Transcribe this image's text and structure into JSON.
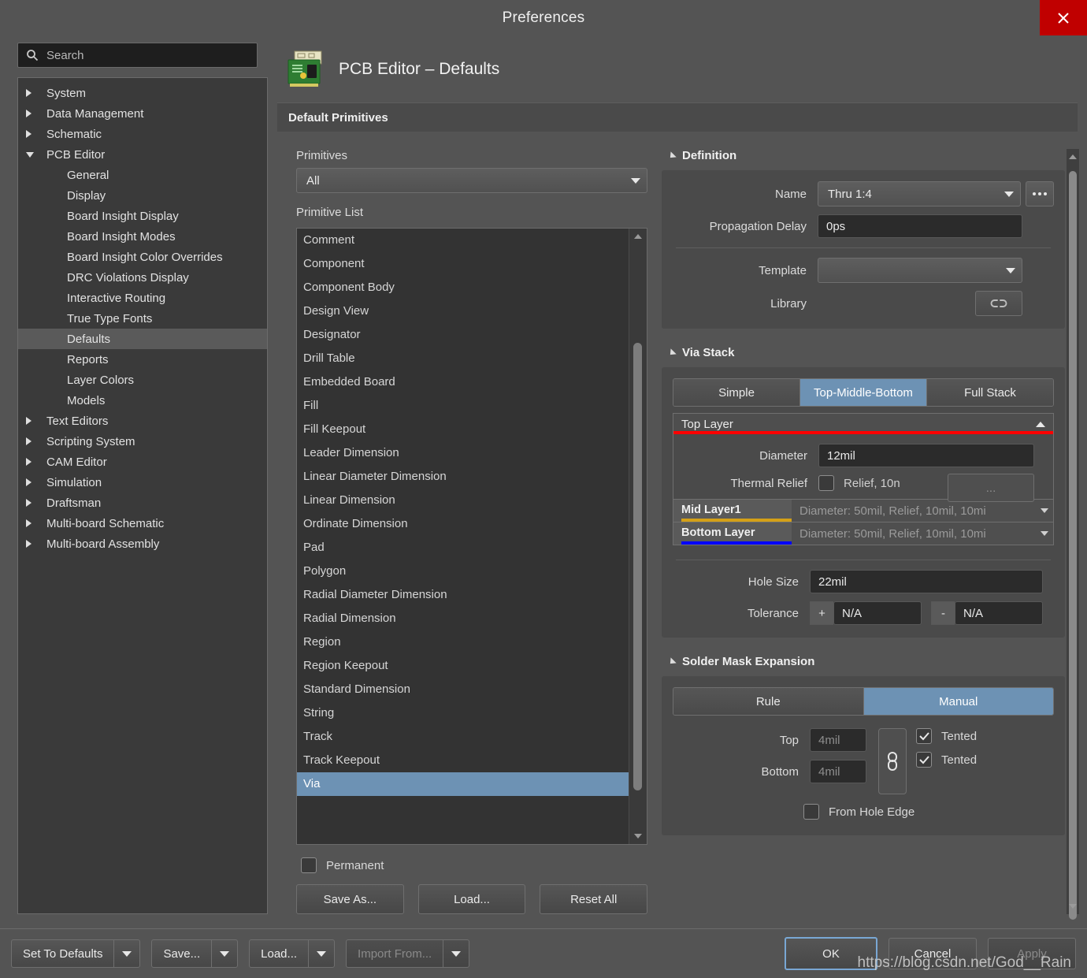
{
  "window": {
    "title": "Preferences",
    "close_label": "×"
  },
  "search": {
    "placeholder": "Search",
    "icon": "search-icon"
  },
  "sidebar": {
    "items": [
      {
        "label": "System",
        "level": 0,
        "expander": "right",
        "selected": false
      },
      {
        "label": "Data Management",
        "level": 0,
        "expander": "right",
        "selected": false
      },
      {
        "label": "Schematic",
        "level": 0,
        "expander": "right",
        "selected": false
      },
      {
        "label": "PCB Editor",
        "level": 0,
        "expander": "down",
        "selected": false
      },
      {
        "label": "General",
        "level": 1,
        "expander": "none",
        "selected": false
      },
      {
        "label": "Display",
        "level": 1,
        "expander": "none",
        "selected": false
      },
      {
        "label": "Board Insight Display",
        "level": 1,
        "expander": "none",
        "selected": false
      },
      {
        "label": "Board Insight Modes",
        "level": 1,
        "expander": "none",
        "selected": false
      },
      {
        "label": "Board Insight Color Overrides",
        "level": 1,
        "expander": "none",
        "selected": false
      },
      {
        "label": "DRC Violations Display",
        "level": 1,
        "expander": "none",
        "selected": false
      },
      {
        "label": "Interactive Routing",
        "level": 1,
        "expander": "none",
        "selected": false
      },
      {
        "label": "True Type Fonts",
        "level": 1,
        "expander": "none",
        "selected": false
      },
      {
        "label": "Defaults",
        "level": 1,
        "expander": "none",
        "selected": true
      },
      {
        "label": "Reports",
        "level": 1,
        "expander": "none",
        "selected": false
      },
      {
        "label": "Layer Colors",
        "level": 1,
        "expander": "none",
        "selected": false
      },
      {
        "label": "Models",
        "level": 1,
        "expander": "none",
        "selected": false
      },
      {
        "label": "Text Editors",
        "level": 0,
        "expander": "right",
        "selected": false
      },
      {
        "label": "Scripting System",
        "level": 0,
        "expander": "right",
        "selected": false
      },
      {
        "label": "CAM Editor",
        "level": 0,
        "expander": "right",
        "selected": false
      },
      {
        "label": "Simulation",
        "level": 0,
        "expander": "right",
        "selected": false
      },
      {
        "label": "Draftsman",
        "level": 0,
        "expander": "right",
        "selected": false
      },
      {
        "label": "Multi-board Schematic",
        "level": 0,
        "expander": "right",
        "selected": false
      },
      {
        "label": "Multi-board Assembly",
        "level": 0,
        "expander": "right",
        "selected": false
      }
    ]
  },
  "page": {
    "title": "PCB Editor – Defaults",
    "icon": "pcb-board-icon",
    "section_title": "Default Primitives"
  },
  "primitives": {
    "filter_label": "Primitives",
    "filter_value": "All",
    "list_label": "Primitive List",
    "items": [
      "Comment",
      "Component",
      "Component Body",
      "Design View",
      "Designator",
      "Drill Table",
      "Embedded Board",
      "Fill",
      "Fill Keepout",
      "Leader Dimension",
      "Linear Diameter Dimension",
      "Linear Dimension",
      "Ordinate Dimension",
      "Pad",
      "Polygon",
      "Radial Diameter Dimension",
      "Radial Dimension",
      "Region",
      "Region Keepout",
      "Standard Dimension",
      "String",
      "Track",
      "Track Keepout",
      "Via"
    ],
    "selected_item": "Via",
    "permanent_label": "Permanent",
    "permanent_checked": false,
    "buttons": {
      "save_as": "Save As...",
      "load": "Load...",
      "reset_all": "Reset All"
    }
  },
  "definition": {
    "title": "Definition",
    "name_label": "Name",
    "name_value": "Thru 1:4",
    "propagation_label": "Propagation Delay",
    "propagation_value": "0ps",
    "template_label": "Template",
    "template_value": "",
    "library_label": "Library",
    "library_icon": "link-icon",
    "more_icon": "ellipsis-icon"
  },
  "via_stack": {
    "title": "Via Stack",
    "modes": [
      "Simple",
      "Top-Middle-Bottom",
      "Full Stack"
    ],
    "active_mode": "Top-Middle-Bottom",
    "top_layer": {
      "name": "Top Layer",
      "color": "#ff0000",
      "expanded": true,
      "diameter_label": "Diameter",
      "diameter_value": "12mil",
      "thermal_label": "Thermal Relief",
      "thermal_checked": false,
      "thermal_value": "Relief, 10n",
      "thermal_more": "..."
    },
    "layers": [
      {
        "name": "Mid Layer1",
        "color": "#d4a017",
        "desc": "Diameter: 50mil, Relief, 10mil, 10mi"
      },
      {
        "name": "Bottom Layer",
        "color": "#0000ff",
        "desc": "Diameter: 50mil, Relief, 10mil, 10mi"
      }
    ],
    "hole_size_label": "Hole Size",
    "hole_size_value": "22mil",
    "tolerance_label": "Tolerance",
    "tolerance_plus_sign": "+",
    "tolerance_plus_value": "N/A",
    "tolerance_minus_sign": "-",
    "tolerance_minus_value": "N/A"
  },
  "solder_mask": {
    "title": "Solder Mask Expansion",
    "modes": [
      "Rule",
      "Manual"
    ],
    "active_mode": "Manual",
    "top_label": "Top",
    "top_value": "4mil",
    "bottom_label": "Bottom",
    "bottom_value": "4mil",
    "top_tented_label": "Tented",
    "top_tented_checked": true,
    "bottom_tented_label": "Tented",
    "bottom_tented_checked": true,
    "from_hole_edge_label": "From Hole Edge",
    "from_hole_edge_checked": false,
    "chain_icon": "link-chain-icon"
  },
  "footer": {
    "set_to_defaults": "Set To Defaults",
    "save": "Save...",
    "load": "Load...",
    "import_from": "Import From...",
    "ok": "OK",
    "cancel": "Cancel",
    "apply": "Apply"
  },
  "watermark": "https://blog.csdn.net/God__Rain",
  "colors": {
    "accent_blue": "#6d92b4",
    "close_red": "#c00000",
    "window_bg": "#545454",
    "panel_bg": "#4a4a4a",
    "input_bg": "#2b2b2b"
  }
}
